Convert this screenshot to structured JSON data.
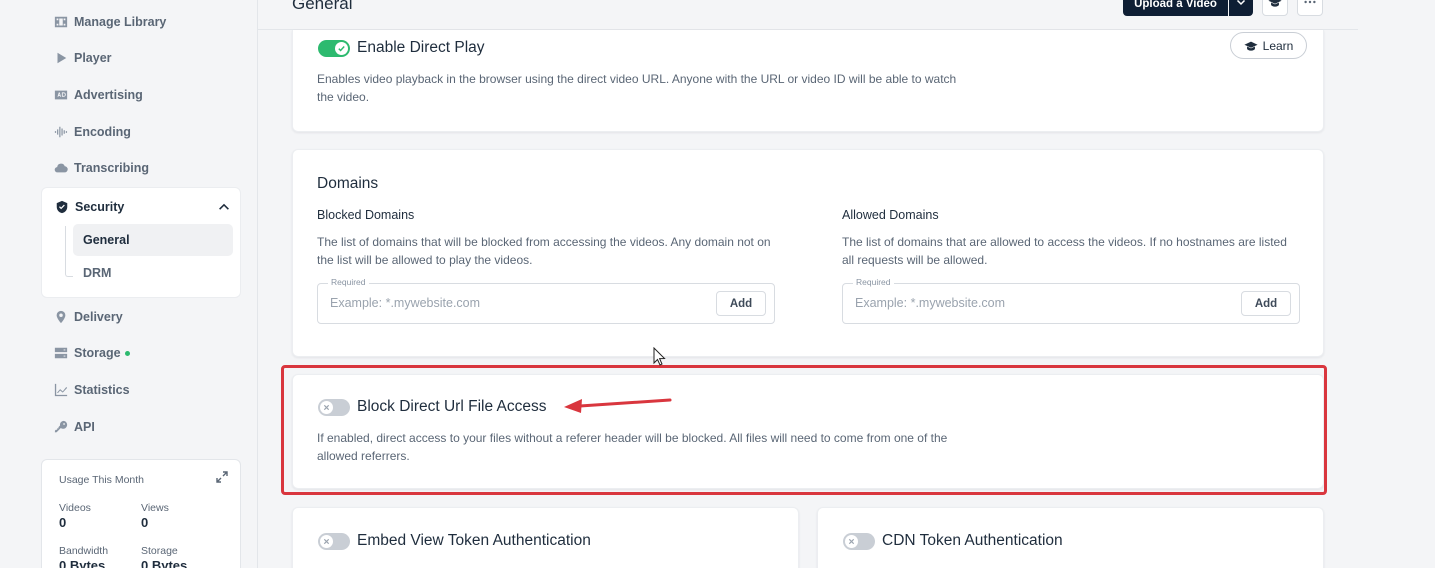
{
  "sidebar": {
    "items": [
      {
        "label": "Manage Library",
        "icon": "film-icon"
      },
      {
        "label": "Player",
        "icon": "play-icon"
      },
      {
        "label": "Advertising",
        "icon": "ad-icon"
      },
      {
        "label": "Encoding",
        "icon": "waveform-icon"
      },
      {
        "label": "Transcribing",
        "icon": "cloud-icon"
      },
      {
        "label": "Delivery",
        "icon": "map-pin-icon"
      },
      {
        "label": "Storage",
        "icon": "server-icon"
      },
      {
        "label": "Statistics",
        "icon": "chart-icon"
      },
      {
        "label": "API",
        "icon": "key-icon"
      }
    ],
    "security": {
      "label": "Security",
      "sub_items": [
        {
          "label": "General",
          "active": true
        },
        {
          "label": "DRM",
          "active": false
        }
      ]
    },
    "usage": {
      "title": "Usage This Month",
      "stats": [
        {
          "label": "Videos",
          "value": "0"
        },
        {
          "label": "Views",
          "value": "0"
        },
        {
          "label": "Bandwidth",
          "value": "0 Bytes"
        },
        {
          "label": "Storage",
          "value": "0 Bytes"
        }
      ]
    }
  },
  "header": {
    "title": "General",
    "upload_label": "Upload a Video"
  },
  "direct_play": {
    "title": "Enable Direct Play",
    "enabled": true,
    "description": "Enables video playback in the browser using the direct video URL. Anyone with the URL or video ID will be able to watch the video.",
    "learn_label": "Learn"
  },
  "domains": {
    "title": "Domains",
    "blocked": {
      "label": "Blocked Domains",
      "description": "The list of domains that will be blocked from accessing the videos. Any domain not on the list will be allowed to play the videos.",
      "required_label": "Required",
      "placeholder": "Example: *.mywebsite.com",
      "add_label": "Add"
    },
    "allowed": {
      "label": "Allowed Domains",
      "description": "The list of domains that are allowed to access the videos. If no hostnames are listed all requests will be allowed.",
      "required_label": "Required",
      "placeholder": "Example: *.mywebsite.com",
      "add_label": "Add"
    }
  },
  "block_direct_url": {
    "title": "Block Direct Url File Access",
    "enabled": false,
    "description": "If enabled, direct access to your files without a referer header will be blocked. All files will need to come from one of the allowed referrers."
  },
  "embed_token": {
    "title": "Embed View Token Authentication",
    "enabled": false
  },
  "cdn_token": {
    "title": "CDN Token Authentication",
    "enabled": false
  },
  "colors": {
    "toggle_on": "#2dba6f",
    "toggle_off": "#c9ced5",
    "highlight": "#d9363e",
    "primary_button": "#0e1e34",
    "status_dot": "#2dba6f"
  }
}
